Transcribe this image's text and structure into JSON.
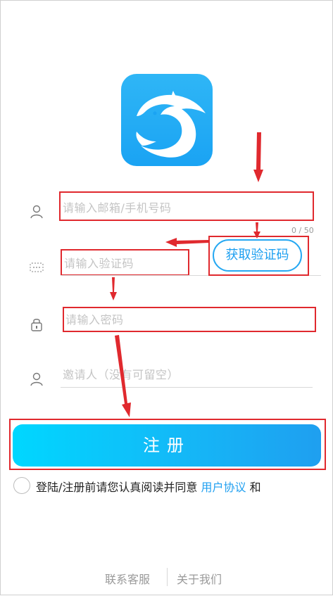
{
  "form": {
    "email_placeholder": "请输入邮箱/手机号码",
    "email_counter": "0 / 50",
    "code_placeholder": "请输入验证码",
    "code_button": "获取验证码",
    "password_placeholder": "请输入密码",
    "invite_placeholder": "邀请人（没有可留空）"
  },
  "submit_label": "注册",
  "agreement": {
    "text": "登陆/注册前请您认真阅读并同意",
    "link": "用户协议",
    "suffix": "和"
  },
  "footer": {
    "contact": "联系客服",
    "about": "关于我们"
  },
  "colors": {
    "accent": "#1f9ff0",
    "annotation": "#e0292e"
  }
}
